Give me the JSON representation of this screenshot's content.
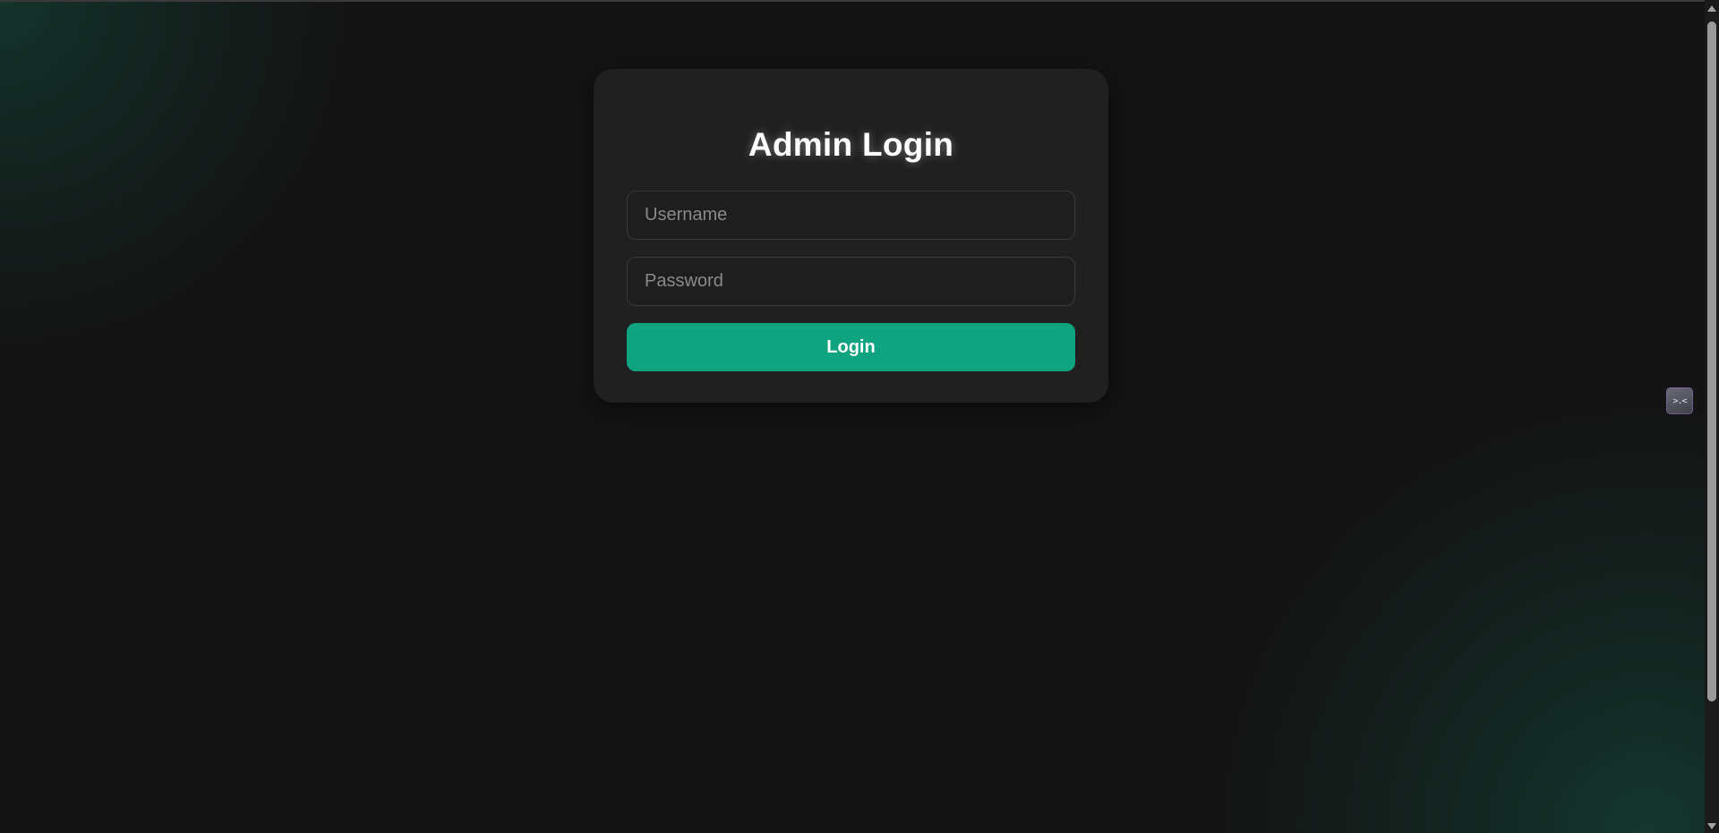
{
  "login": {
    "title": "Admin Login",
    "username_placeholder": "Username",
    "password_placeholder": "Password",
    "username_value": "",
    "password_value": "",
    "submit_label": "Login"
  },
  "extension": {
    "icon": "face-glyph-icon",
    "glyph": ">.<"
  },
  "colors": {
    "background": "#141414",
    "card": "#202020",
    "accent": "#10a37f",
    "glow": "#134e3e"
  }
}
